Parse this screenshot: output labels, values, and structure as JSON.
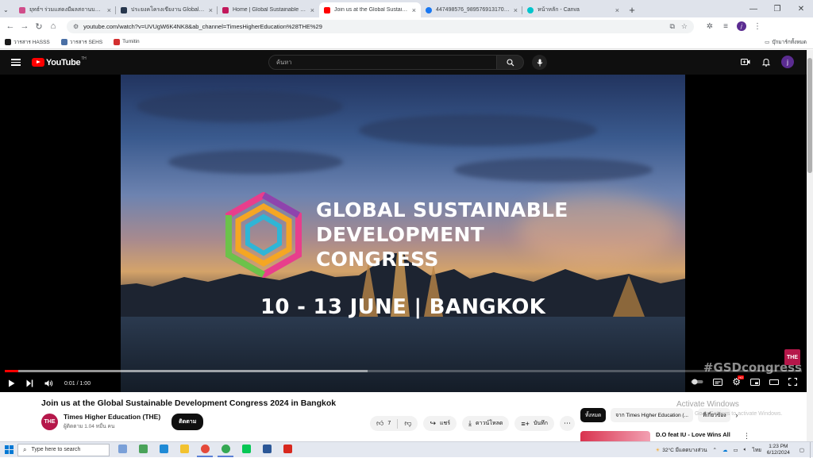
{
  "browser": {
    "tabs": [
      {
        "title": "ยุทธ์ฯ ร่วมแสดงมีผลสถานบอฟงำน...",
        "fav": "#d04d8a",
        "active": false
      },
      {
        "title": "ประยงคโครงเขียงาน Global Sustaina...",
        "fav": "#27374d",
        "active": false
      },
      {
        "title": "Home | Global Sustainable Dev...",
        "fav": "#c2185b",
        "active": false
      },
      {
        "title": "Join us at the Global Sustainab...",
        "fav": "#ff0000",
        "active": true
      },
      {
        "title": "447498576_989576913170141...",
        "fav": "#1877f2",
        "active": false
      },
      {
        "title": "หน้าหลัก - Canva",
        "fav": "#00c4cc",
        "active": false
      }
    ],
    "new_tab": "+",
    "url": "youtube.com/watch?v=UVUgW6K4NK8&ab_channel=TimesHigherEducation%28THE%29",
    "profile_initial": "j",
    "bookmarks": [
      {
        "label": "วารสาร HASSS",
        "color": "#1b1b1b"
      },
      {
        "label": "วารสาร SEHS",
        "color": "#4a6fa5"
      },
      {
        "label": "Turnitin",
        "color": "#d32f2f"
      }
    ],
    "all_bookmarks": "บุ๊กมาร์กทั้งหมด"
  },
  "youtube": {
    "logo_text": "YouTube",
    "logo_sup": "TH",
    "search_placeholder": "ค้นหา",
    "avatar_initial": "j",
    "video": {
      "title_line1": "GLOBAL SUSTAINABLE",
      "title_line2": "DEVELOPMENT",
      "title_line3": "CONGRESS",
      "dates": "10 - 13 JUNE | BANGKOK",
      "hashtag": "#GSDcongress",
      "badge": "THE",
      "time": "0:01 / 1:00",
      "played_pct": 1.7,
      "buffered_pct": 45.5
    },
    "details": {
      "title": "Join us at the Global Sustainable Development Congress 2024 in Bangkok",
      "channel": "Times Higher Education (THE)",
      "channel_avatar": "THE",
      "subscribers": "ผู้ติดตาม 1.04 หมื่น คน",
      "subscribe": "ติดตาม",
      "likes": "7",
      "share": "แชร์",
      "download": "ดาวน์โหลด",
      "save": "บันทึก"
    },
    "chips": [
      "ทั้งหมด",
      "จาก Times Higher Education (...",
      "ที่เกี่ยวข้อง"
    ],
    "recommended": {
      "title": "D.O feat IU - Love Wins All"
    }
  },
  "watermark": {
    "title": "Activate Windows",
    "sub": "Go to Settings to activate Windows."
  },
  "taskbar": {
    "search_placeholder": "Type here to search",
    "weather": "32°C มีแดดบางส่วน",
    "lang": "ไทย",
    "time": "1:23 PM",
    "date": "6/12/2024",
    "apps": [
      {
        "name": "widgets",
        "color": "#7aa0d8",
        "run": false
      },
      {
        "name": "task-view",
        "color": "#4aa35a",
        "run": false
      },
      {
        "name": "edge",
        "color": "#1f8ad6",
        "run": false
      },
      {
        "name": "file-explorer",
        "color": "#f2c230",
        "run": false
      },
      {
        "name": "chrome",
        "color": "#e5493a",
        "run": true
      },
      {
        "name": "chrome-profile",
        "color": "#34a853",
        "run": true
      },
      {
        "name": "line",
        "color": "#06c755",
        "run": false
      },
      {
        "name": "word",
        "color": "#2b5797",
        "run": false
      },
      {
        "name": "acrobat",
        "color": "#d8281e",
        "run": false
      }
    ]
  }
}
